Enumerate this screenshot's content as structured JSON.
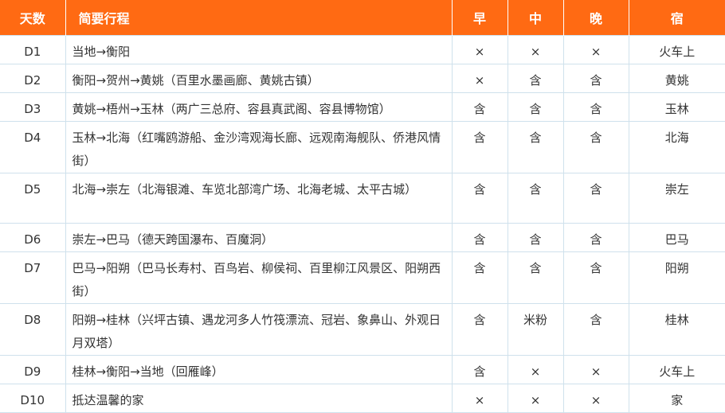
{
  "header": {
    "day": "天数",
    "route": "简要行程",
    "breakfast": "早",
    "lunch": "中",
    "dinner": "晚",
    "stay": "宿"
  },
  "rows": [
    {
      "day": "D1",
      "route": "当地→衡阳",
      "breakfast": "×",
      "lunch": "×",
      "dinner": "×",
      "stay": "火车上"
    },
    {
      "day": "D2",
      "route": "衡阳→贺州→黄姚（百里水墨画廊、黄姚古镇）",
      "breakfast": "×",
      "lunch": "含",
      "dinner": "含",
      "stay": "黄姚"
    },
    {
      "day": "D3",
      "route": "黄姚→梧州→玉林（两广三总府、容县真武阁、容县博物馆）",
      "breakfast": "含",
      "lunch": "含",
      "dinner": "含",
      "stay": "玉林"
    },
    {
      "day": "D4",
      "route": "玉林→北海（红嘴鸥游船、金沙湾观海长廊、远观南海舰队、侨港风情街）",
      "breakfast": "含",
      "lunch": "含",
      "dinner": "含",
      "stay": "北海"
    },
    {
      "day": "D5",
      "route": "北海→崇左（北海银滩、车览北部湾广场、北海老城、太平古城）",
      "breakfast": "含",
      "lunch": "含",
      "dinner": "含",
      "stay": "崇左"
    },
    {
      "day": "D6",
      "route": "崇左→巴马（德天跨国瀑布、百魔洞）",
      "breakfast": "含",
      "lunch": "含",
      "dinner": "含",
      "stay": "巴马"
    },
    {
      "day": "D7",
      "route": "巴马→阳朔（巴马长寿村、百鸟岩、柳侯祠、百里柳江风景区、阳朔西街）",
      "breakfast": "含",
      "lunch": "含",
      "dinner": "含",
      "stay": "阳朔"
    },
    {
      "day": "D8",
      "route": "阳朔→桂林（兴坪古镇、遇龙河多人竹筏漂流、冠岩、象鼻山、外观日月双塔）",
      "breakfast": "含",
      "lunch": "米粉",
      "dinner": "含",
      "stay": "桂林"
    },
    {
      "day": "D9",
      "route": "桂林→衡阳→当地（回雁峰）",
      "breakfast": "含",
      "lunch": "×",
      "dinner": "×",
      "stay": "火车上"
    },
    {
      "day": "D10",
      "route": "抵达温馨的家",
      "breakfast": "×",
      "lunch": "×",
      "dinner": "×",
      "stay": "家"
    }
  ]
}
